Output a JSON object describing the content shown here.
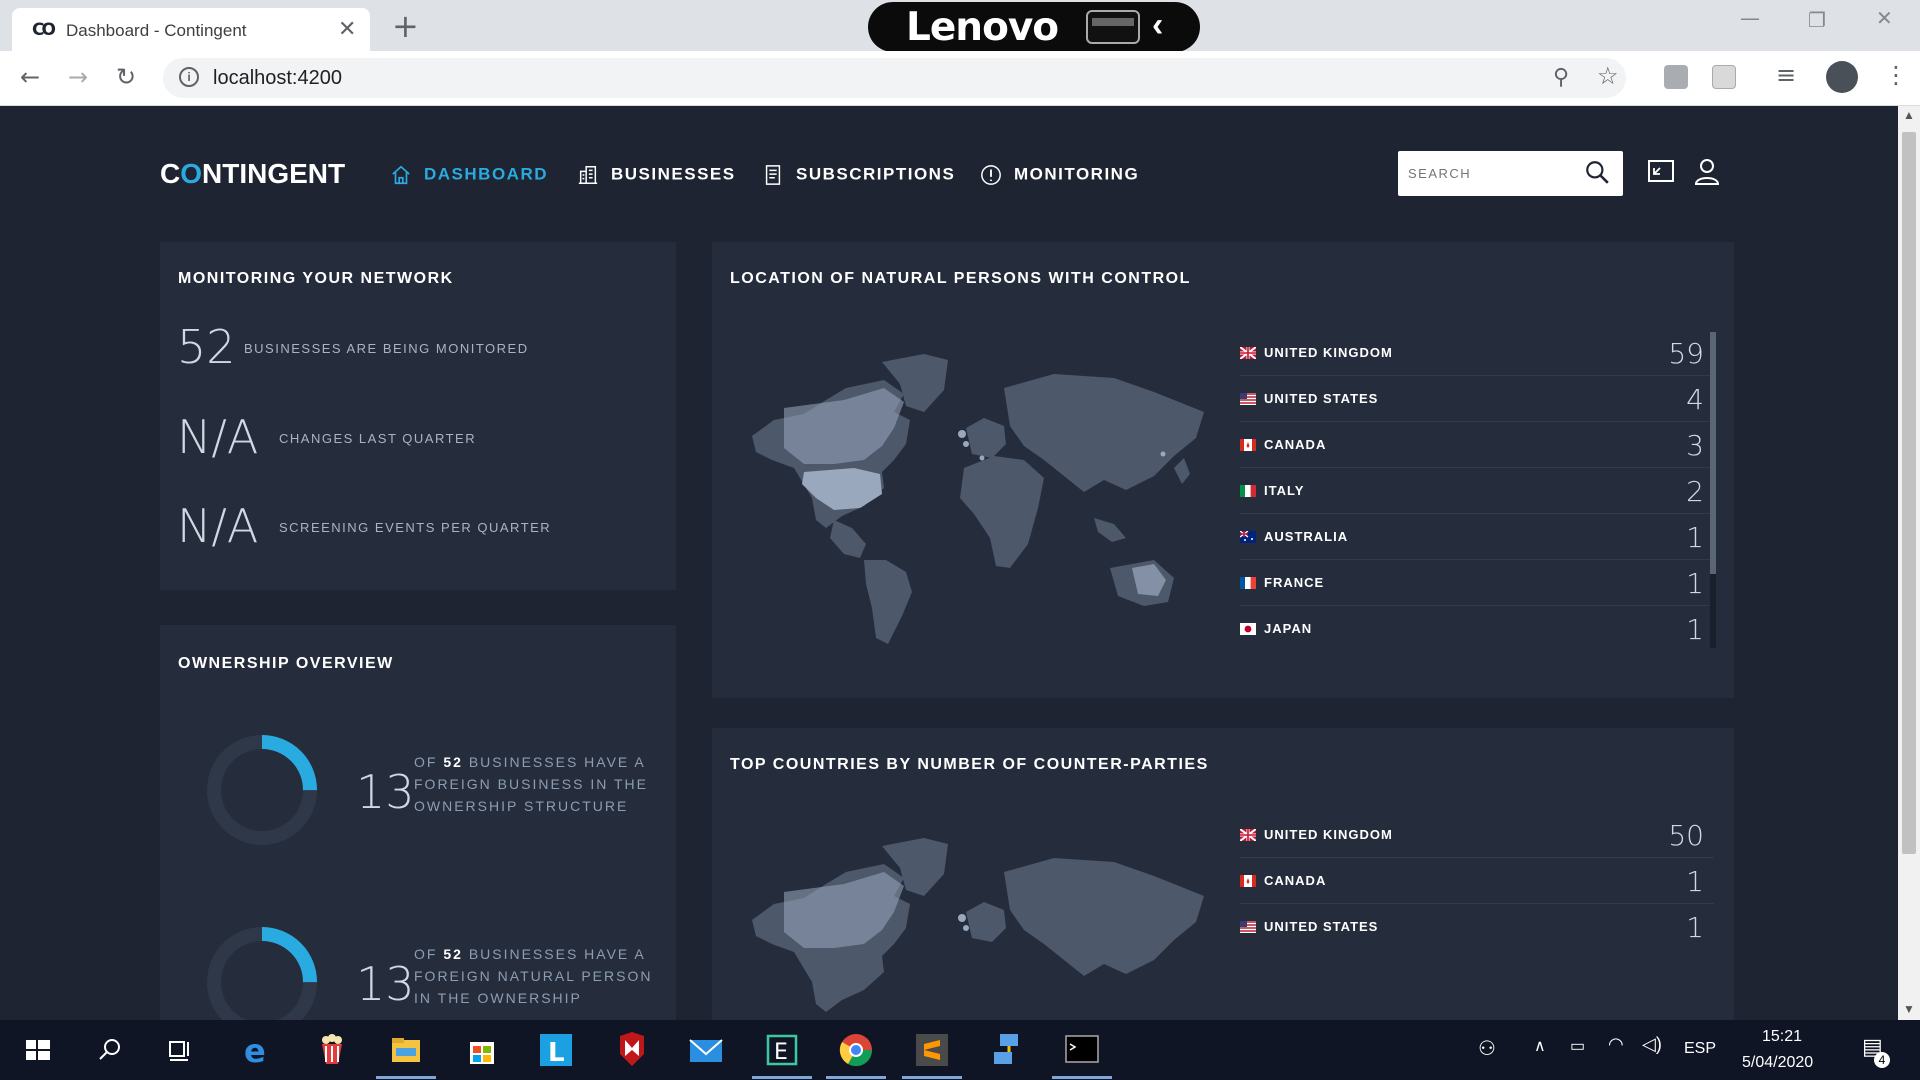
{
  "browser": {
    "tab_title": "Dashboard - Contingent",
    "tab_logo": "CO",
    "close_tab": "✕",
    "new_tab": "+",
    "url": "localhost:4200",
    "lenovo": "Lenovo",
    "icons": [
      "back-arrow-icon",
      "forward-arrow-icon",
      "reload-icon",
      "info-icon",
      "zoom-icon",
      "star-icon",
      "extension-icon",
      "media-icon",
      "profile-icon",
      "menu-icon"
    ]
  },
  "app": {
    "brand_c": "C",
    "brand_o": "O",
    "brand_rest": "NTINGENT",
    "nav": [
      "DASHBOARD",
      "BUSINESSES",
      "SUBSCRIPTIONS",
      "MONITORING"
    ],
    "search_placeholder": "SEARCH",
    "accent": "#29abe2",
    "bg": "#1e2431",
    "panel_bg": "#252d3c"
  },
  "monitoring": {
    "title": "MONITORING YOUR NETWORK",
    "stats": [
      {
        "value": "52",
        "label": "BUSINESSES ARE BEING MONITORED"
      },
      {
        "value": "N/A",
        "label": "CHANGES LAST QUARTER"
      },
      {
        "value": "N/A",
        "label": "SCREENING EVENTS PER QUARTER"
      }
    ]
  },
  "ownership": {
    "title": "OWNERSHIP OVERVIEW",
    "items": [
      {
        "value": "13",
        "fraction": 0.25,
        "of": "OF",
        "total": "52",
        "line1_rest": "BUSINESSES HAVE A",
        "line2": "FOREIGN BUSINESS IN THE",
        "line3": "OWNERSHIP STRUCTURE"
      },
      {
        "value": "13",
        "fraction": 0.25,
        "of": "OF",
        "total": "52",
        "line1_rest": "BUSINESSES HAVE A",
        "line2": "FOREIGN NATURAL PERSON",
        "line3": "IN THE OWNERSHIP"
      }
    ]
  },
  "location": {
    "title": "LOCATION OF NATURAL PERSONS WITH CONTROL",
    "rows": [
      {
        "country": "UNITED KINGDOM",
        "count": "59",
        "flag": "uk"
      },
      {
        "country": "UNITED STATES",
        "count": "4",
        "flag": "us"
      },
      {
        "country": "CANADA",
        "count": "3",
        "flag": "ca"
      },
      {
        "country": "ITALY",
        "count": "2",
        "flag": "it"
      },
      {
        "country": "AUSTRALIA",
        "count": "1",
        "flag": "au"
      },
      {
        "country": "FRANCE",
        "count": "1",
        "flag": "fr"
      },
      {
        "country": "JAPAN",
        "count": "1",
        "flag": "jp"
      }
    ]
  },
  "counterparties": {
    "title": "TOP COUNTRIES BY NUMBER OF COUNTER-PARTIES",
    "rows": [
      {
        "country": "UNITED KINGDOM",
        "count": "50",
        "flag": "uk"
      },
      {
        "country": "CANADA",
        "count": "1",
        "flag": "ca"
      },
      {
        "country": "UNITED STATES",
        "count": "1",
        "flag": "us"
      }
    ]
  },
  "taskbar": {
    "language": "ESP",
    "time": "15:21",
    "date": "5/04/2020",
    "notifications": "4",
    "apps": [
      "windows-start-icon",
      "search-icon",
      "task-view-icon",
      "edge-icon",
      "popcorn-icon",
      "file-explorer-icon",
      "store-icon",
      "l-app-icon",
      "mcafee-icon",
      "mail-icon",
      "e-app-icon",
      "chrome-icon",
      "sublime-icon",
      "network-app-icon",
      "terminal-icon"
    ]
  }
}
